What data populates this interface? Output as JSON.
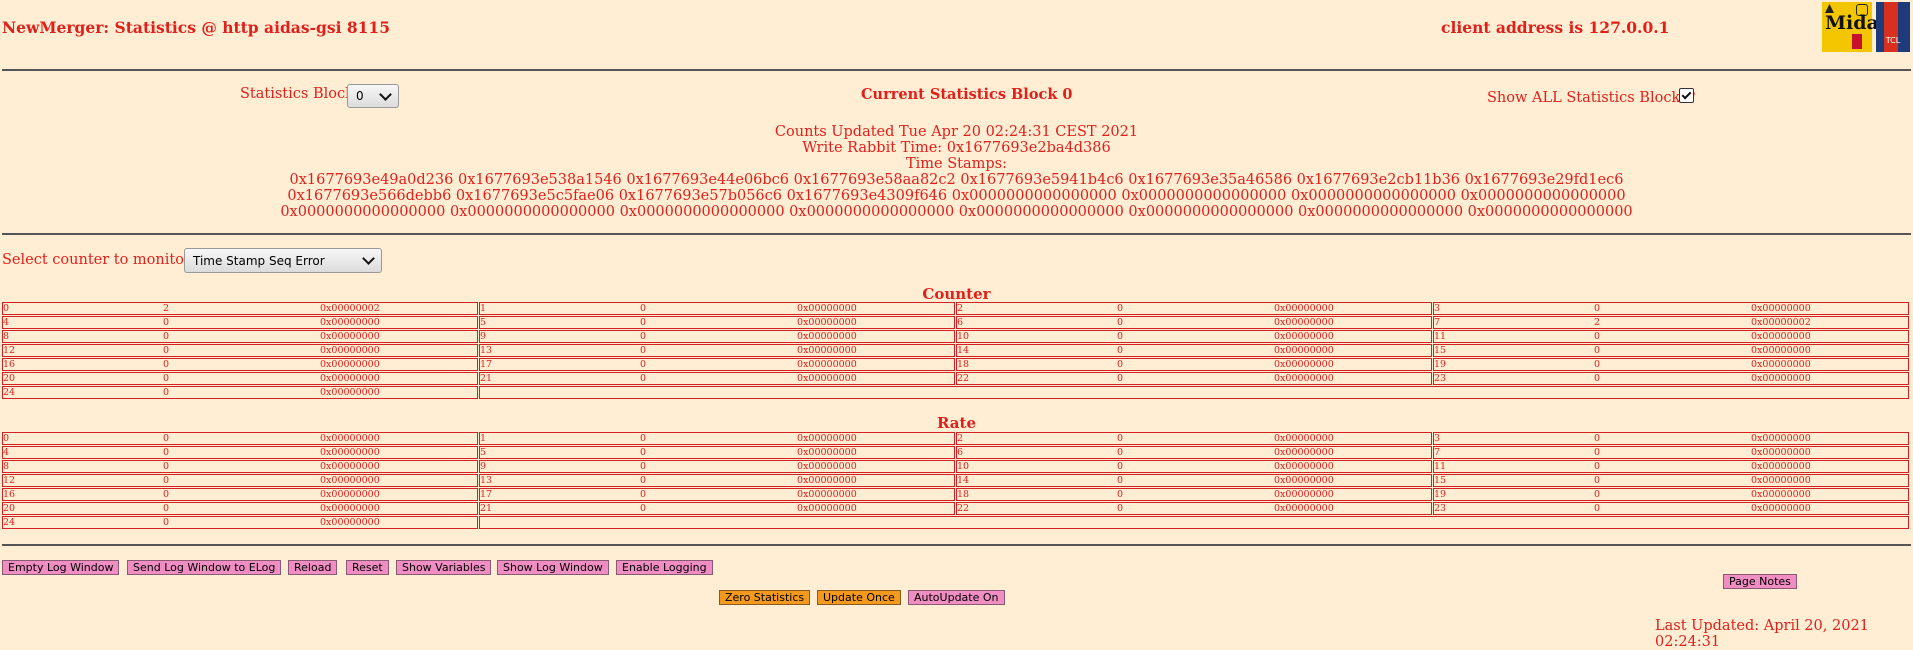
{
  "header": {
    "title": "NewMerger: Statistics @ http aidas-gsi 8115",
    "client": "client address is 127.0.0.1",
    "logo1_text": "Midas",
    "logo2_text": "TCL"
  },
  "controls": {
    "block_label": "Statistics Block",
    "block_value": "0",
    "current_block": "Current Statistics Block 0",
    "show_all_label": "Show ALL Statistics Blocks?",
    "show_all_checked": true
  },
  "info": {
    "counts_updated": "Counts Updated Tue Apr 20 02:24:31 CEST 2021",
    "write_rabbit": "Write Rabbit Time: 0x1677693e2ba4d386",
    "timestamps_label": "Time Stamps:",
    "timestamps_line1": "0x1677693e49a0d236 0x1677693e538a1546 0x1677693e44e06bc6 0x1677693e58aa82c2 0x1677693e5941b4c6 0x1677693e35a46586 0x1677693e2cb11b36 0x1677693e29fd1ec6",
    "timestamps_line2": "0x1677693e566debb6 0x1677693e5c5fae06 0x1677693e57b056c6 0x1677693e4309f646 0x0000000000000000 0x0000000000000000 0x0000000000000000 0x0000000000000000",
    "timestamps_line3": "0x0000000000000000 0x0000000000000000 0x0000000000000000 0x0000000000000000 0x0000000000000000 0x0000000000000000 0x0000000000000000 0x0000000000000000"
  },
  "monitor": {
    "label": "Select counter to monitor",
    "selected": "Time Stamp Seq Error"
  },
  "counter": {
    "title": "Counter",
    "cells": [
      [
        "0",
        "2",
        "0x00000002"
      ],
      [
        "1",
        "0",
        "0x00000000"
      ],
      [
        "2",
        "0",
        "0x00000000"
      ],
      [
        "3",
        "0",
        "0x00000000"
      ],
      [
        "4",
        "0",
        "0x00000000"
      ],
      [
        "5",
        "0",
        "0x00000000"
      ],
      [
        "6",
        "0",
        "0x00000000"
      ],
      [
        "7",
        "2",
        "0x00000002"
      ],
      [
        "8",
        "0",
        "0x00000000"
      ],
      [
        "9",
        "0",
        "0x00000000"
      ],
      [
        "10",
        "0",
        "0x00000000"
      ],
      [
        "11",
        "0",
        "0x00000000"
      ],
      [
        "12",
        "0",
        "0x00000000"
      ],
      [
        "13",
        "0",
        "0x00000000"
      ],
      [
        "14",
        "0",
        "0x00000000"
      ],
      [
        "15",
        "0",
        "0x00000000"
      ],
      [
        "16",
        "0",
        "0x00000000"
      ],
      [
        "17",
        "0",
        "0x00000000"
      ],
      [
        "18",
        "0",
        "0x00000000"
      ],
      [
        "19",
        "0",
        "0x00000000"
      ],
      [
        "20",
        "0",
        "0x00000000"
      ],
      [
        "21",
        "0",
        "0x00000000"
      ],
      [
        "22",
        "0",
        "0x00000000"
      ],
      [
        "23",
        "0",
        "0x00000000"
      ],
      [
        "24",
        "0",
        "0x00000000"
      ]
    ]
  },
  "rate": {
    "title": "Rate",
    "cells": [
      [
        "0",
        "0",
        "0x00000000"
      ],
      [
        "1",
        "0",
        "0x00000000"
      ],
      [
        "2",
        "0",
        "0x00000000"
      ],
      [
        "3",
        "0",
        "0x00000000"
      ],
      [
        "4",
        "0",
        "0x00000000"
      ],
      [
        "5",
        "0",
        "0x00000000"
      ],
      [
        "6",
        "0",
        "0x00000000"
      ],
      [
        "7",
        "0",
        "0x00000000"
      ],
      [
        "8",
        "0",
        "0x00000000"
      ],
      [
        "9",
        "0",
        "0x00000000"
      ],
      [
        "10",
        "0",
        "0x00000000"
      ],
      [
        "11",
        "0",
        "0x00000000"
      ],
      [
        "12",
        "0",
        "0x00000000"
      ],
      [
        "13",
        "0",
        "0x00000000"
      ],
      [
        "14",
        "0",
        "0x00000000"
      ],
      [
        "15",
        "0",
        "0x00000000"
      ],
      [
        "16",
        "0",
        "0x00000000"
      ],
      [
        "17",
        "0",
        "0x00000000"
      ],
      [
        "18",
        "0",
        "0x00000000"
      ],
      [
        "19",
        "0",
        "0x00000000"
      ],
      [
        "20",
        "0",
        "0x00000000"
      ],
      [
        "21",
        "0",
        "0x00000000"
      ],
      [
        "22",
        "0",
        "0x00000000"
      ],
      [
        "23",
        "0",
        "0x00000000"
      ],
      [
        "24",
        "0",
        "0x00000000"
      ]
    ]
  },
  "buttons": {
    "empty_log": "Empty Log Window",
    "send_log": "Send Log Window to ELog",
    "reload": "Reload",
    "reset": "Reset",
    "show_variables": "Show Variables",
    "show_log": "Show Log Window",
    "enable_logging": "Enable Logging",
    "page_notes": "Page Notes",
    "zero_stats": "Zero Statistics",
    "update_once": "Update Once",
    "autoupdate": "AutoUpdate On"
  },
  "footer": {
    "last_updated": "Last Updated: April 20, 2021 02:24:31"
  }
}
